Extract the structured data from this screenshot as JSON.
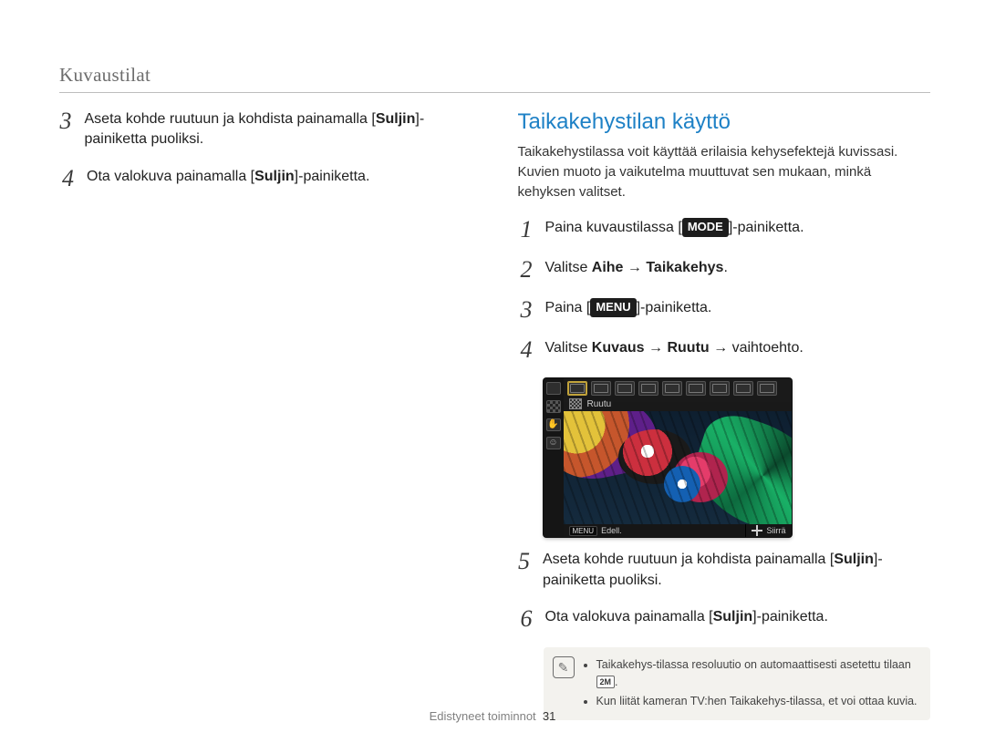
{
  "header": "Kuvaustilat",
  "left": {
    "steps": [
      {
        "n": "3",
        "t1": "Aseta kohde ruutuun ja kohdista painamalla [",
        "b1": "Suljin",
        "t2": "]-painiketta puoliksi."
      },
      {
        "n": "4",
        "t1": "Ota valokuva painamalla [",
        "b1": "Suljin",
        "t2": "]-painiketta."
      }
    ]
  },
  "right": {
    "title": "Taikakehystilan käyttö",
    "intro": "Taikakehystilassa voit käyttää erilaisia kehysefektejä kuvissasi. Kuvien muoto ja vaikutelma muuttuvat sen mukaan, minkä kehyksen valitset.",
    "steps": [
      {
        "n": "1",
        "t1": "Paina kuvaustilassa [",
        "chip": "MODE",
        "t2": "]-painiketta."
      },
      {
        "n": "2",
        "t1": "Valitse ",
        "b1": "Aihe",
        "arrow1": " → ",
        "b2": "Taikakehys",
        "t2": "."
      },
      {
        "n": "3",
        "t1": "Paina [",
        "chip": "MENU",
        "t2": "]-painiketta."
      },
      {
        "n": "4",
        "t1": "Valitse ",
        "b1": "Kuvaus",
        "arrow1": " → ",
        "b2": "Ruutu",
        "arrow2": " → ",
        "t2": "vaihtoehto."
      }
    ],
    "lcd": {
      "subbar_label": "Ruutu",
      "bottom_left_chip": "MENU",
      "bottom_left_label": "Edell.",
      "bottom_right_label": "Siirrä"
    },
    "steps_after": [
      {
        "n": "5",
        "t1": "Aseta kohde ruutuun ja kohdista painamalla [",
        "b1": "Suljin",
        "t2": "]-painiketta puoliksi."
      },
      {
        "n": "6",
        "t1": "Ota valokuva painamalla [",
        "b1": "Suljin",
        "t2": "]-painiketta."
      }
    ],
    "note": {
      "items": [
        {
          "pre": "Taikakehys-tilassa resoluutio on automaattisesti asetettu tilaan ",
          "chip": "2M",
          "post": "."
        },
        {
          "pre": "Kun liität kameran TV:hen Taikakehys-tilassa, et voi ottaa kuvia.",
          "chip": "",
          "post": ""
        }
      ]
    }
  },
  "footer": {
    "section": "Edistyneet toiminnot",
    "page": "31"
  }
}
